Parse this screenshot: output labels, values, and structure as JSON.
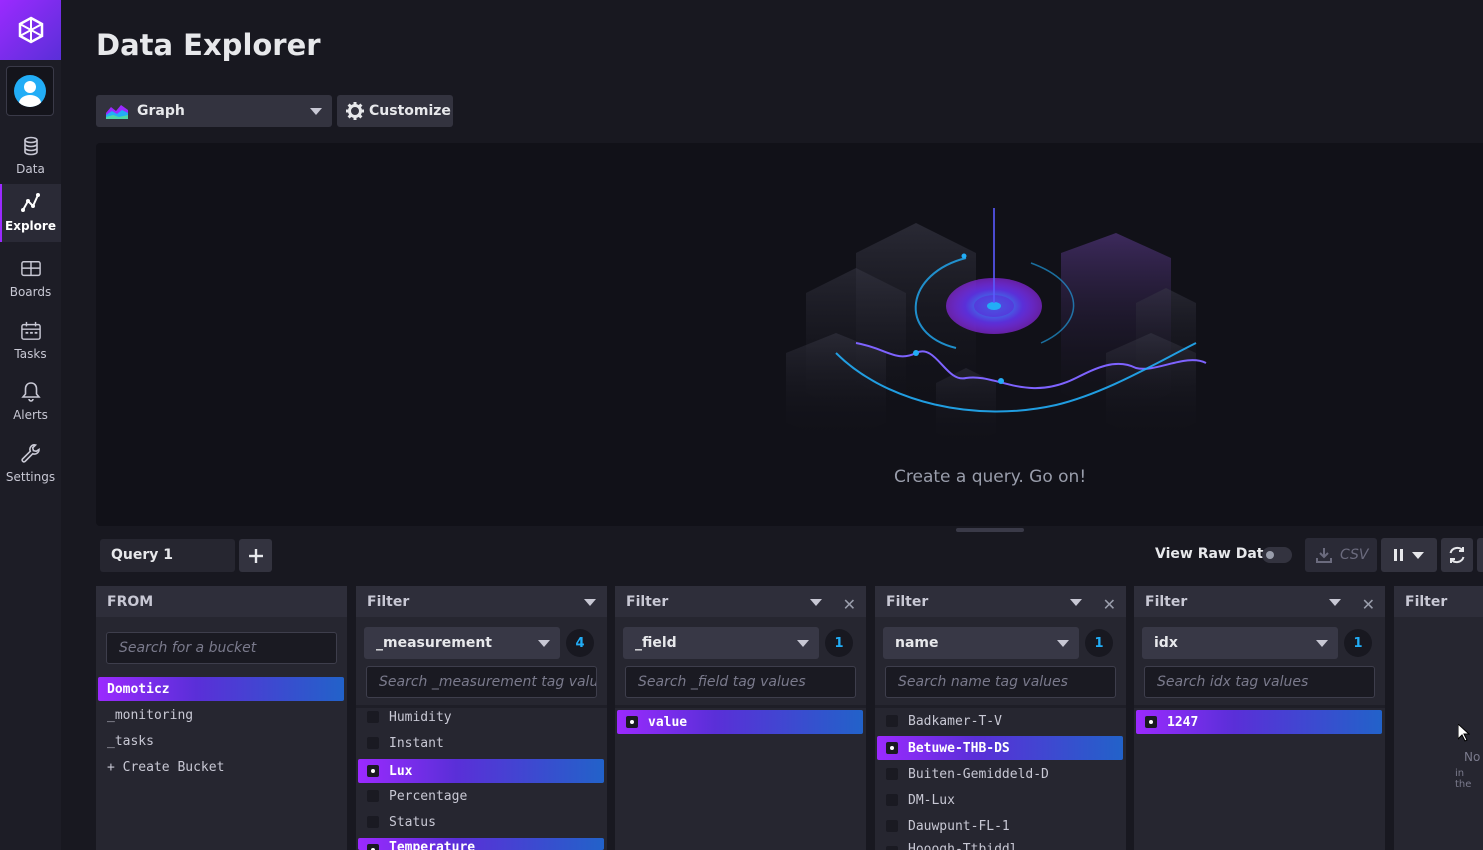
{
  "page": {
    "title": "Data Explorer"
  },
  "sidebar": {
    "items": [
      {
        "label": "Data",
        "icon": "database-icon",
        "active": false
      },
      {
        "label": "Explore",
        "icon": "graph-line-icon",
        "active": true
      },
      {
        "label": "Boards",
        "icon": "dashboards-icon",
        "active": false
      },
      {
        "label": "Tasks",
        "icon": "calendar-icon",
        "active": false
      },
      {
        "label": "Alerts",
        "icon": "bell-icon",
        "active": false
      },
      {
        "label": "Settings",
        "icon": "wrench-icon",
        "active": false
      }
    ]
  },
  "toolbar": {
    "graph_type": "Graph",
    "customize_label": "Customize"
  },
  "graph": {
    "empty_message": "Create a query. Go on!"
  },
  "query_bar": {
    "tab_label": "Query 1",
    "raw_data_label": "View Raw Data",
    "csv_label": "CSV"
  },
  "builder": {
    "from": {
      "header": "FROM",
      "search_placeholder": "Search for a bucket",
      "buckets": [
        "Domoticz",
        "_monitoring",
        "_tasks"
      ],
      "selected": "Domoticz",
      "create_label": "+ Create Bucket"
    },
    "filters": [
      {
        "header": "Filter",
        "key": "_measurement",
        "count": "4",
        "search_placeholder": "Search _measurement tag values",
        "values": [
          {
            "label": "Humidity",
            "selected": false
          },
          {
            "label": "Instant",
            "selected": false
          },
          {
            "label": "Lux",
            "selected": true
          },
          {
            "label": "Percentage",
            "selected": false
          },
          {
            "label": "Status",
            "selected": false
          },
          {
            "label": "Temperature",
            "selected": true
          }
        ]
      },
      {
        "header": "Filter",
        "key": "_field",
        "count": "1",
        "search_placeholder": "Search _field tag values",
        "values": [
          {
            "label": "value",
            "selected": true
          }
        ]
      },
      {
        "header": "Filter",
        "key": "name",
        "count": "1",
        "search_placeholder": "Search name tag values",
        "values": [
          {
            "label": "Badkamer-T-V",
            "selected": false
          },
          {
            "label": "Betuwe-THB-DS",
            "selected": true
          },
          {
            "label": "Buiten-Gemiddeld-D",
            "selected": false
          },
          {
            "label": "DM-Lux",
            "selected": false
          },
          {
            "label": "Dauwpunt-FL-1",
            "selected": false
          },
          {
            "label": "Hooogh-Ttbiddl",
            "selected": false
          }
        ]
      },
      {
        "header": "Filter",
        "key": "idx",
        "count": "1",
        "search_placeholder": "Search idx tag values",
        "values": [
          {
            "label": "1247",
            "selected": true
          }
        ]
      }
    ],
    "last_filter": {
      "header": "Filter",
      "empty_line1": "No",
      "empty_line2": "in the"
    }
  },
  "colors": {
    "accent_purple": "#9b2aff",
    "accent_blue": "#22adf6",
    "background": "#181820"
  }
}
